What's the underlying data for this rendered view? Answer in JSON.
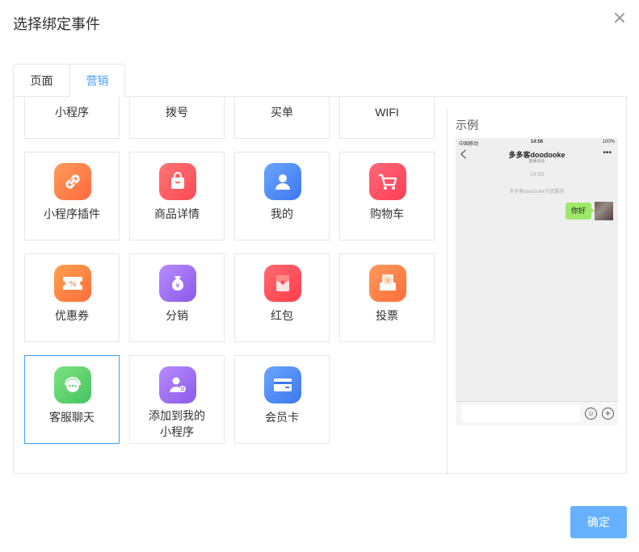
{
  "dialog": {
    "title": "选择绑定事件"
  },
  "tabs": [
    {
      "label": "页面",
      "active": false
    },
    {
      "label": "营销",
      "active": true
    }
  ],
  "events": [
    {
      "label": "小程序",
      "icon": ""
    },
    {
      "label": "拨号",
      "icon": ""
    },
    {
      "label": "买单",
      "icon": ""
    },
    {
      "label": "WIFI",
      "icon": ""
    },
    {
      "label": "小程序插件",
      "icon": "link-icon",
      "color": "#ff7a45"
    },
    {
      "label": "商品详情",
      "icon": "shopping-bag-icon",
      "color": "#ff5b5b"
    },
    {
      "label": "我的",
      "icon": "user-icon",
      "color": "#4d8bf5"
    },
    {
      "label": "购物车",
      "icon": "cart-icon",
      "color": "#ff4d61"
    },
    {
      "label": "优惠券",
      "icon": "coupon-icon",
      "color": "#ff8a3d"
    },
    {
      "label": "分销",
      "icon": "money-bag-icon",
      "color": "#9a6bf0"
    },
    {
      "label": "红包",
      "icon": "red-envelope-icon",
      "color": "#ff4d5a"
    },
    {
      "label": "投票",
      "icon": "ballot-box-icon",
      "color": "#ff7a45"
    },
    {
      "label": "客服聊天",
      "icon": "chat-service-icon",
      "color": "#5ed06e",
      "selected": true
    },
    {
      "label_line1": "添加到我的",
      "label_line2": "小程序",
      "icon": "add-to-miniprogram-icon",
      "color": "#9a6bf0"
    },
    {
      "label": "会员卡",
      "icon": "member-card-icon",
      "color": "#4d8bf5"
    }
  ],
  "example": {
    "label": "示例",
    "phone": {
      "carrier": "中国移动",
      "time": "14:56",
      "battery": "100%",
      "chat_title": "多多客doodooke",
      "chat_subtitle": "客服会话",
      "message_time": "14:55",
      "system_message": "多多客doodooke为您服务",
      "bubble_text": "你好"
    }
  },
  "footer": {
    "confirm_label": "确定"
  }
}
